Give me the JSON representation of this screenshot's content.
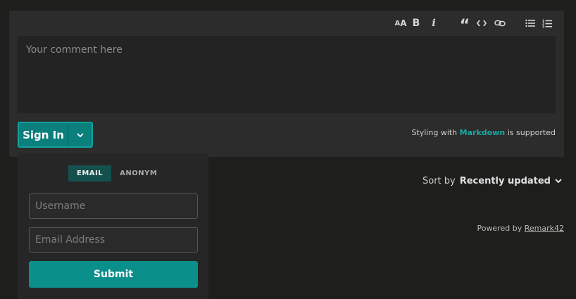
{
  "toolbar": {
    "items": [
      {
        "name": "heading",
        "icon": "text-size-icon",
        "glyph": "AA"
      },
      {
        "name": "bold",
        "icon": "bold-icon",
        "glyph": "B"
      },
      {
        "name": "italic",
        "icon": "italic-icon",
        "glyph": "i"
      },
      {
        "name": "quote",
        "icon": "quote-icon",
        "glyph": "“"
      },
      {
        "name": "code",
        "icon": "code-icon",
        "glyph": "<>"
      },
      {
        "name": "link",
        "icon": "link-icon",
        "glyph": "link"
      },
      {
        "name": "unordered-list",
        "icon": "bullet-list-icon",
        "glyph": "ul"
      },
      {
        "name": "ordered-list",
        "icon": "numbered-list-icon",
        "glyph": "ol"
      }
    ]
  },
  "editor": {
    "placeholder": "Your comment here"
  },
  "signin": {
    "label": "Sign In",
    "caret_icon": "chevron-down-icon"
  },
  "markdown_note": {
    "prefix": "Styling with",
    "link": "Markdown",
    "suffix": "is supported"
  },
  "auth_dropdown": {
    "tabs": [
      {
        "label": "EMAIL",
        "active": true
      },
      {
        "label": "ANONYM",
        "active": false
      }
    ],
    "username_placeholder": "Username",
    "email_placeholder": "Email Address",
    "submit_label": "Submit"
  },
  "sort": {
    "label": "Sort by",
    "value": "Recently updated",
    "icon": "chevron-down-icon"
  },
  "powered": {
    "prefix": "Powered by",
    "link": "Remark42"
  },
  "colors": {
    "accent": "#0a8f8b",
    "link": "#18a9a2",
    "background": "#1e1e1c",
    "panel": "#2c2c2c"
  }
}
